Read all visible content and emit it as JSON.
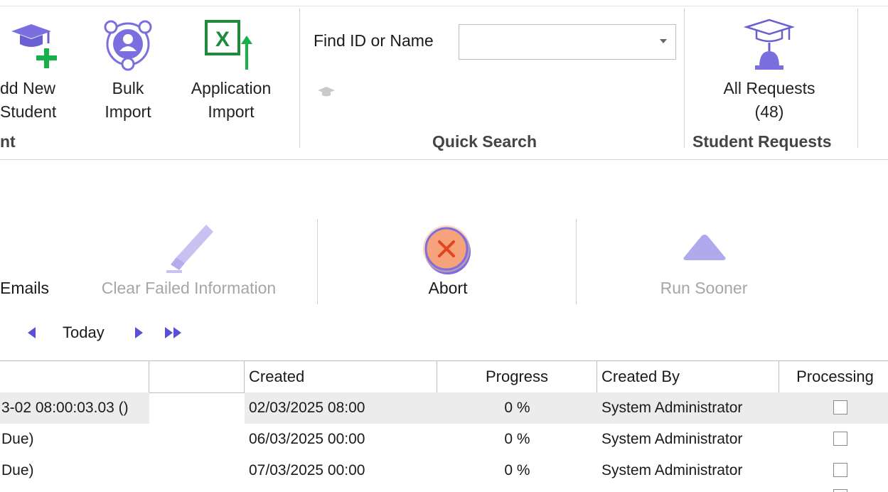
{
  "ribbon": {
    "buttons": [
      {
        "name": "add-new-student",
        "line1": "dd New",
        "line2": "Student",
        "icon": "graduation-cap-plus-icon"
      },
      {
        "name": "bulk-import",
        "line1": "Bulk",
        "line2": "Import",
        "icon": "user-circle-icon"
      },
      {
        "name": "application-import",
        "line1": "Application",
        "line2": "Import",
        "icon": "excel-import-icon"
      }
    ],
    "group_left_label": "nt",
    "quick_search": {
      "label": "Find ID or Name",
      "value": "",
      "group_label": "Quick Search"
    },
    "student_requests": {
      "line1": "All Requests",
      "line2": "(48)",
      "group_label": "Student Requests",
      "icon": "graduation-bell-icon"
    }
  },
  "toolbar": {
    "emails_label": "Emails",
    "clear_failed_label": "Clear Failed Information",
    "abort_label": "Abort",
    "run_sooner_label": "Run Sooner"
  },
  "nav": {
    "today_label": "Today"
  },
  "grid": {
    "columns": [
      "",
      "",
      "Created",
      "Progress",
      "Created By",
      "Processing"
    ],
    "rows": [
      {
        "col0": "3-02 08:00:03.03 ()",
        "created": "02/03/2025 08:00",
        "progress": "0 %",
        "created_by": "System Administrator",
        "processing": false
      },
      {
        "col0": "Due)",
        "created": "06/03/2025 00:00",
        "progress": "0 %",
        "created_by": "System Administrator",
        "processing": false
      },
      {
        "col0": "Due)",
        "created": "07/03/2025 00:00",
        "progress": "0 %",
        "created_by": "System Administrator",
        "processing": false
      }
    ]
  },
  "colors": {
    "accent": "#7b6fdf",
    "abort_fill": "#f6a27a",
    "abort_x": "#e2451f",
    "excel_green": "#1f8a3b",
    "plus_green": "#16b14a"
  }
}
